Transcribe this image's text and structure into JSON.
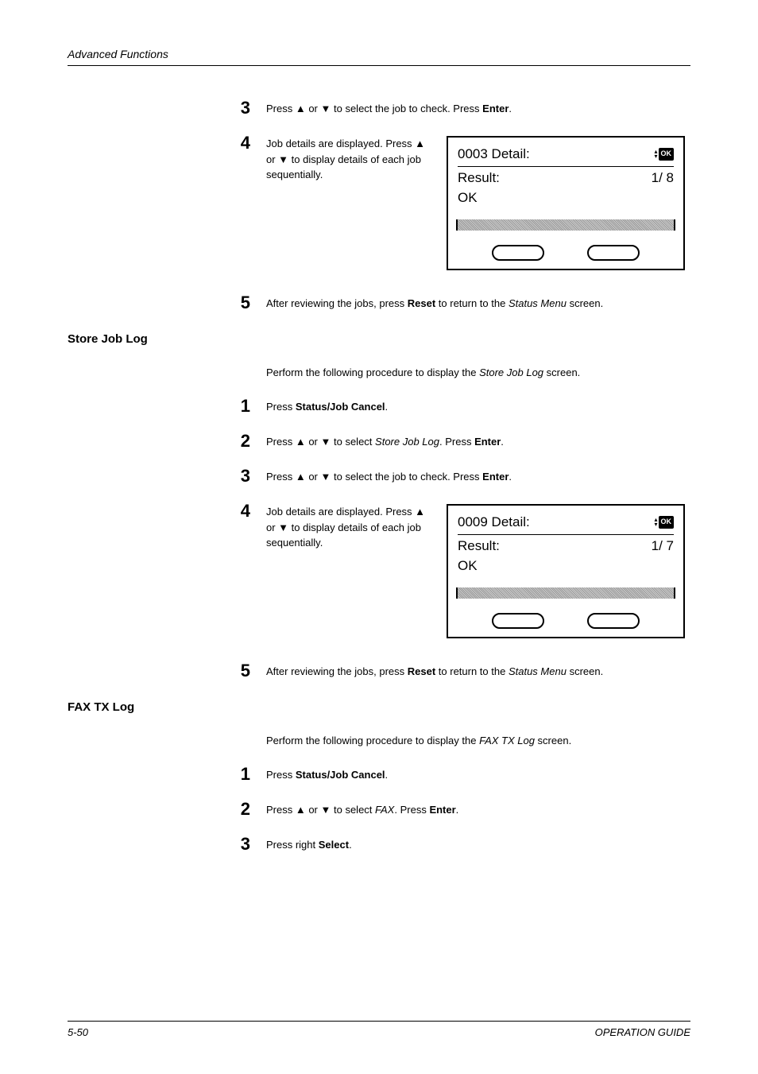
{
  "header": "Advanced Functions",
  "steps_a": {
    "s3": {
      "num": "3",
      "text_pre": "Press ",
      "arrow1": "▲",
      "mid": " or ",
      "arrow2": "▼",
      "text_post": " to select the job to check. Press ",
      "bold": "Enter",
      "end": "."
    },
    "s4": {
      "num": "4",
      "line1": "Job details are displayed. Press ",
      "arrow1": "▲",
      "mid": " or ",
      "arrow2": "▼",
      "line2": " to display details of each job sequentially."
    },
    "s5": {
      "num": "5",
      "text_pre": "After reviewing the jobs, press ",
      "bold": "Reset",
      "text_mid": " to return to the ",
      "italic": "Status Menu",
      "text_post": " screen."
    }
  },
  "display_a": {
    "title": "0003   Detail:",
    "ok_label": "OK",
    "result_label": "Result:",
    "result_val": "1/ 8",
    "ok": "OK"
  },
  "section_b": {
    "heading": "Store Job Log",
    "intro_pre": "Perform the following procedure to display the ",
    "intro_italic": "Store Job Log",
    "intro_post": " screen."
  },
  "steps_b": {
    "s1": {
      "num": "1",
      "text_pre": "Press ",
      "bold": "Status/Job Cancel",
      "end": "."
    },
    "s2": {
      "num": "2",
      "text_pre": "Press ",
      "arrow1": "▲",
      "mid": " or ",
      "arrow2": "▼",
      "text_mid": " to select ",
      "italic": "Store Job Log",
      "text_post": ". Press ",
      "bold": "Enter",
      "end": "."
    },
    "s3": {
      "num": "3",
      "text_pre": "Press ",
      "arrow1": "▲",
      "mid": " or ",
      "arrow2": "▼",
      "text_post": " to select the job to check. Press ",
      "bold": "Enter",
      "end": "."
    },
    "s4": {
      "num": "4",
      "line1": "Job details are displayed. Press ",
      "arrow1": "▲",
      "mid": " or ",
      "arrow2": "▼",
      "line2": " to display details of each job sequentially."
    },
    "s5": {
      "num": "5",
      "text_pre": "After reviewing the jobs, press ",
      "bold": "Reset",
      "text_mid": " to return to the ",
      "italic": "Status Menu",
      "text_post": " screen."
    }
  },
  "display_b": {
    "title": "0009   Detail:",
    "ok_label": "OK",
    "result_label": "Result:",
    "result_val": "1/ 7",
    "ok": "OK"
  },
  "section_c": {
    "heading": "FAX TX Log",
    "intro_pre": "Perform the following procedure to display the ",
    "intro_italic": "FAX TX Log",
    "intro_post": " screen."
  },
  "steps_c": {
    "s1": {
      "num": "1",
      "text_pre": "Press ",
      "bold": "Status/Job Cancel",
      "end": "."
    },
    "s2": {
      "num": "2",
      "text_pre": "Press ",
      "arrow1": "▲",
      "mid": " or ",
      "arrow2": "▼",
      "text_mid": " to select ",
      "italic": "FAX",
      "text_post": ". Press ",
      "bold": "Enter",
      "end": "."
    },
    "s3": {
      "num": "3",
      "text_pre": "Press right ",
      "bold": "Select",
      "end": "."
    }
  },
  "footer": {
    "page": "5-50",
    "right": "OPERATION GUIDE"
  }
}
